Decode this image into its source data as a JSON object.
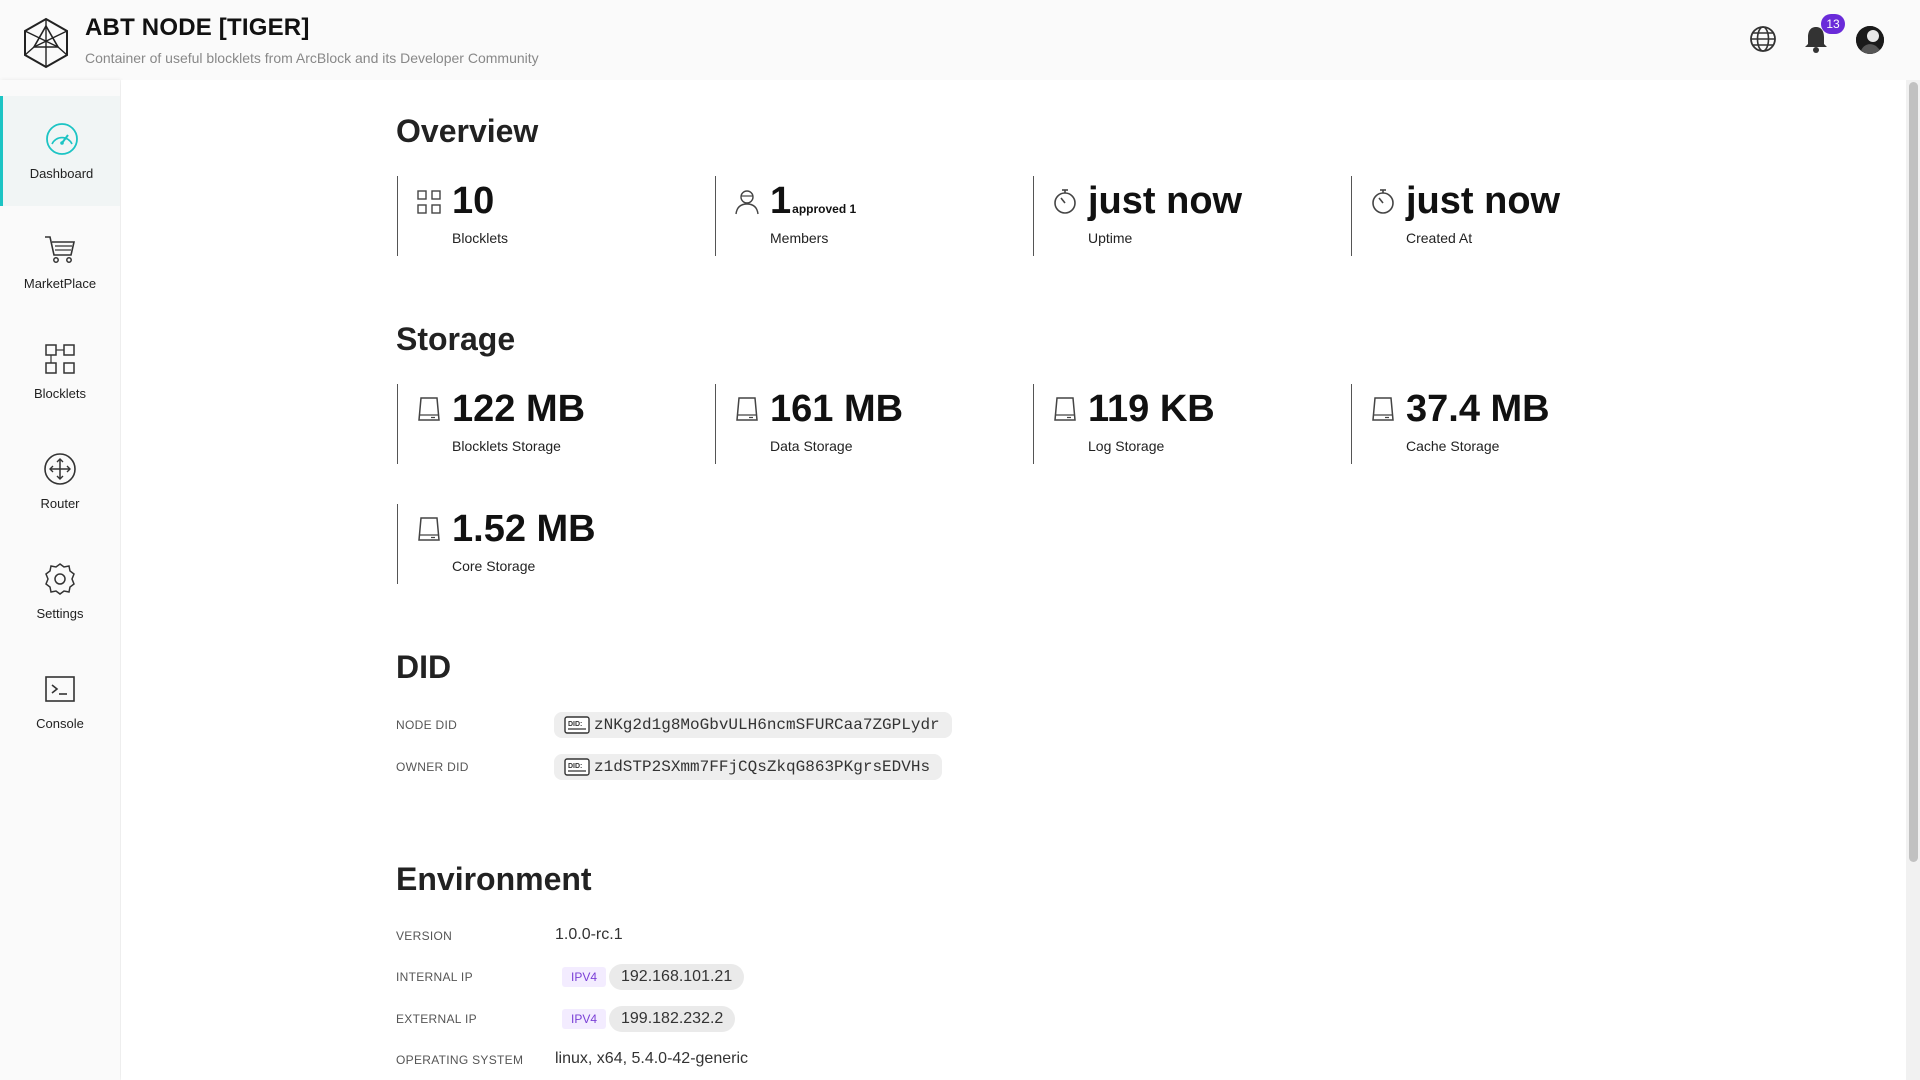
{
  "header": {
    "title": "ABT NODE [TIGER]",
    "subtitle": "Container of useful blocklets from ArcBlock and its Developer Community",
    "notifications_count": "13",
    "icons": [
      "globe-icon",
      "bell-icon",
      "avatar"
    ]
  },
  "sidebar": {
    "items": [
      {
        "label": "Dashboard",
        "icon": "dashboard-gauge-icon",
        "active": true
      },
      {
        "label": "MarketPlace",
        "icon": "cart-icon",
        "active": false
      },
      {
        "label": "Blocklets",
        "icon": "blocklets-grid-icon",
        "active": false
      },
      {
        "label": "Router",
        "icon": "router-icon",
        "active": false
      },
      {
        "label": "Settings",
        "icon": "gear-icon",
        "active": false
      },
      {
        "label": "Console",
        "icon": "terminal-icon",
        "active": false
      }
    ]
  },
  "overview": {
    "title": "Overview",
    "stats": [
      {
        "value": "10",
        "sub": "",
        "label": "Blocklets",
        "icon": "blocklets-grid-icon"
      },
      {
        "value": "1",
        "sub": "approved 1",
        "label": "Members",
        "icon": "members-icon"
      },
      {
        "value": "just now",
        "sub": "",
        "label": "Uptime",
        "icon": "stopwatch-icon"
      },
      {
        "value": "just now",
        "sub": "",
        "label": "Created At",
        "icon": "stopwatch-icon"
      }
    ]
  },
  "storage": {
    "title": "Storage",
    "stats": [
      {
        "value": "122 MB",
        "label": "Blocklets Storage",
        "icon": "storage-drive-icon"
      },
      {
        "value": "161 MB",
        "label": "Data Storage",
        "icon": "storage-drive-icon"
      },
      {
        "value": "119 KB",
        "label": "Log Storage",
        "icon": "storage-drive-icon"
      },
      {
        "value": "37.4 MB",
        "label": "Cache Storage",
        "icon": "storage-drive-icon"
      },
      {
        "value": "1.52 MB",
        "label": "Core Storage",
        "icon": "storage-drive-icon"
      }
    ]
  },
  "did": {
    "title": "DID",
    "node_label": "NODE DID",
    "node_value": "zNKg2d1g8MoGbvULH6ncmSFURCaa7ZGPLydr",
    "owner_label": "OWNER DID",
    "owner_value": "z1dSTP2SXmm7FFjCQsZkqG863PKgrsEDVHs"
  },
  "environment": {
    "title": "Environment",
    "version_label": "VERSION",
    "version_value": "1.0.0-rc.1",
    "internal_ip_label": "INTERNAL IP",
    "internal_ip_tag": "IPV4",
    "internal_ip_value": "192.168.101.21",
    "external_ip_label": "EXTERNAL IP",
    "external_ip_tag": "IPV4",
    "external_ip_value": "199.182.232.2",
    "os_label": "OPERATING SYSTEM",
    "os_value": "linux, x64, 5.4.0-42-generic"
  },
  "colors": {
    "accent": "#1cc4c4",
    "badge": "#6a2bd9",
    "ip_tag": "#7a3fd6"
  }
}
